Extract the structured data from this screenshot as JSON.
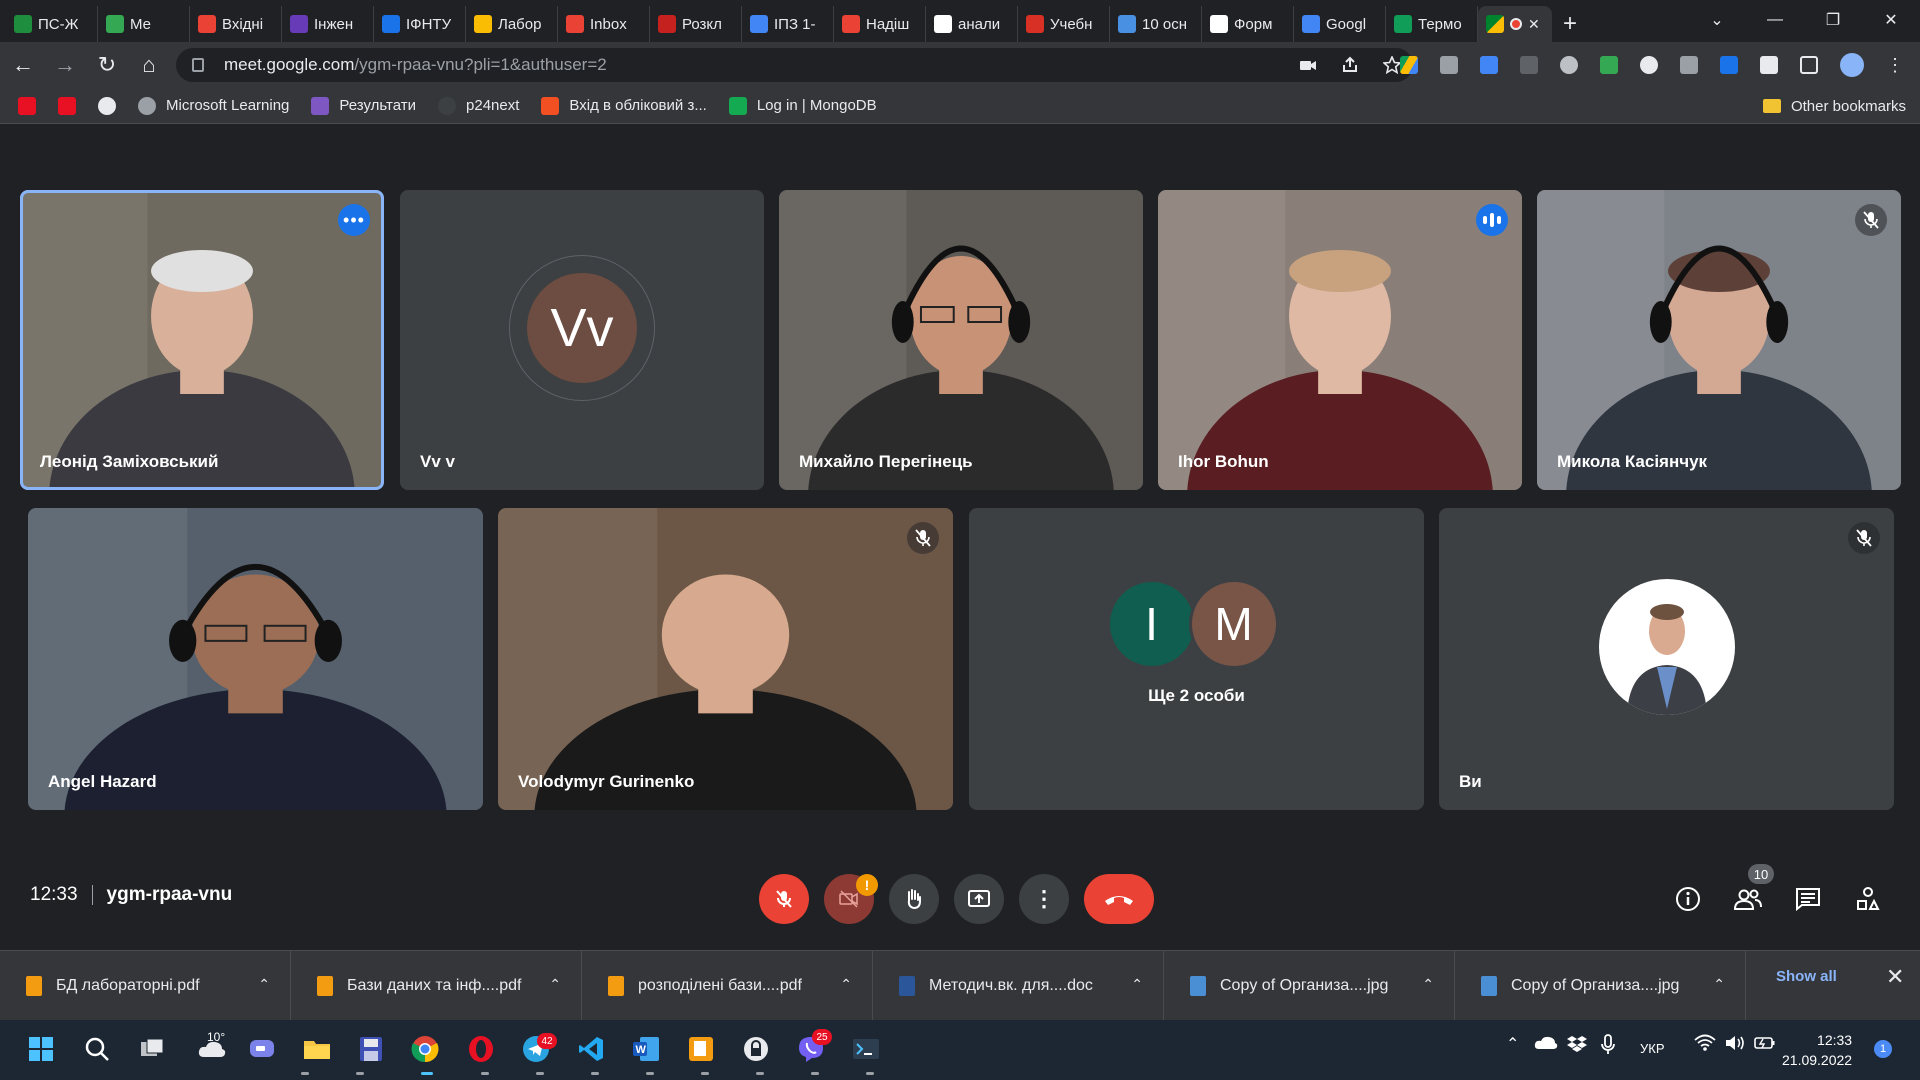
{
  "browser": {
    "tabs": [
      {
        "title": "ПС-Ж",
        "color": "#1e8e3e"
      },
      {
        "title": "Ме",
        "color": "#34a853"
      },
      {
        "title": "Вхідні",
        "color": "#ea4335"
      },
      {
        "title": "Інжен",
        "color": "#673ab7"
      },
      {
        "title": "ІФНТУ",
        "color": "#1a73e8"
      },
      {
        "title": "Лабор",
        "color": "#fbbc04"
      },
      {
        "title": "Inbox",
        "color": "#ea4335"
      },
      {
        "title": "Розкл",
        "color": "#c5221f"
      },
      {
        "title": "ІПЗ 1-",
        "color": "#4285f4"
      },
      {
        "title": "Надіш",
        "color": "#ea4335"
      },
      {
        "title": "анали",
        "color": "#ffffff"
      },
      {
        "title": "Учебн",
        "color": "#d93025"
      },
      {
        "title": "10 осн",
        "color": "#4a90e2"
      },
      {
        "title": "Форм",
        "color": "#ffffff"
      },
      {
        "title": "Googl",
        "color": "#4285f4"
      },
      {
        "title": "Термо",
        "color": "#0f9d58"
      }
    ],
    "window_controls": {
      "minimize": "—",
      "restore": "❐",
      "close": "✕"
    },
    "url_host": "meet.google.com",
    "url_path": "/ygm-rpaa-vnu?pli=1&authuser=2",
    "bookmarks": [
      {
        "label": "Microsoft Learning",
        "icon": "globe-icon",
        "color": "#9aa0a6"
      },
      {
        "label": "Результати",
        "icon": "results-icon",
        "color": "#7e57c2"
      },
      {
        "label": "p24next",
        "icon": "p24-icon",
        "color": "#3c4043"
      },
      {
        "label": "Вхід в обліковий з...",
        "icon": "microsoft-icon",
        "color": "#f25022"
      },
      {
        "label": "Log in | MongoDB",
        "icon": "mongodb-icon",
        "color": "#13aa52"
      }
    ],
    "other_bookmarks": "Other bookmarks"
  },
  "meet": {
    "participants": [
      {
        "name": "Леонід Заміховський",
        "type": "video",
        "selected": true,
        "badge": "more",
        "bg": "#6f6a5f"
      },
      {
        "name": "Vv v",
        "type": "avatar",
        "initials": "Vv",
        "avatar_color": "#6d4c41"
      },
      {
        "name": "Михайло Перегінець",
        "type": "video",
        "bg": "#5e5a55"
      },
      {
        "name": "Ihor Bohun",
        "type": "video",
        "badge": "speaking",
        "bg": "#8a7f78"
      },
      {
        "name": "Микола Касіянчук",
        "type": "video",
        "badge": "muted",
        "bg": "#7e8289"
      },
      {
        "name": "Angel Hazard",
        "type": "video",
        "bg": "#55606c"
      },
      {
        "name": "Volodymyr Gurinenko",
        "type": "video",
        "badge": "muted",
        "bg": "#6c5747"
      },
      {
        "name": "Ще 2 особи",
        "type": "group",
        "avatars": [
          {
            "initial": "I",
            "color": "#0f5e4f"
          },
          {
            "initial": "M",
            "color": "#795548"
          }
        ]
      },
      {
        "name": "Ви",
        "type": "self",
        "badge": "muted"
      }
    ],
    "time": "12:33",
    "meeting_code": "ygm-rpaa-vnu",
    "people_count": "10",
    "camera_alert": "!"
  },
  "downloads": {
    "items": [
      {
        "name": "БД лабораторні.pdf",
        "type": "pdf"
      },
      {
        "name": "Бази даних та інф....pdf",
        "type": "pdf"
      },
      {
        "name": "розподілені бази....pdf",
        "type": "pdf"
      },
      {
        "name": "Методич.вк. для....doc",
        "type": "doc"
      },
      {
        "name": "Copy of Организа....jpg",
        "type": "jpg"
      },
      {
        "name": "Copy of Организа....jpg",
        "type": "jpg"
      }
    ],
    "show_all": "Show all"
  },
  "taskbar": {
    "weather_temp": "10°",
    "telegram_badge": "42",
    "viber_badge": "25",
    "language": "УКР",
    "time": "12:33",
    "date": "21.09.2022",
    "notifications": "1"
  }
}
